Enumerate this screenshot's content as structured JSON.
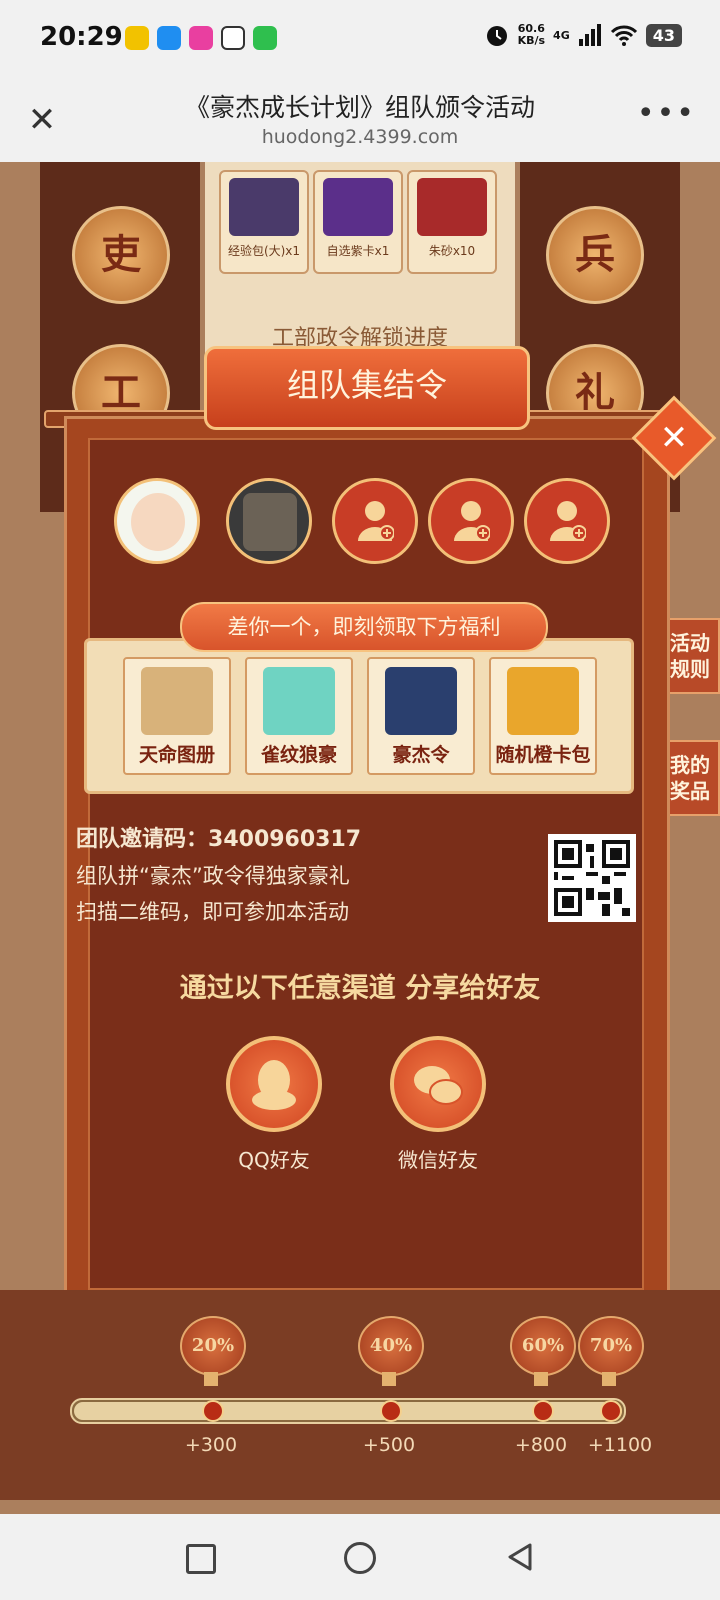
{
  "status_bar": {
    "time": "20:29",
    "speed_value": "60.6",
    "speed_unit": "KB/s",
    "network": "4G",
    "battery": "43"
  },
  "nav": {
    "close_icon": "close-icon",
    "title": "《豪杰成长计划》组队颁令活动",
    "url": "huodong2.4399.com",
    "more_icon": "more-icon"
  },
  "background": {
    "coins": [
      "吏",
      "兵",
      "工",
      "礼"
    ],
    "items": [
      {
        "label": "经验包(大)x1"
      },
      {
        "label": "自选紫卡x1"
      },
      {
        "label": "朱砂x10"
      }
    ],
    "progress_title": "工部政令解锁进度"
  },
  "side_tabs": {
    "rules": "活动规则",
    "prizes": "我的奖品"
  },
  "modal": {
    "title": "组队集结令",
    "banner": "差你一个，即刻领取下方福利",
    "rewards": [
      {
        "label": "天命图册"
      },
      {
        "label": "雀纹狼豪"
      },
      {
        "label": "豪杰令"
      },
      {
        "label": "随机橙卡包"
      }
    ],
    "invite_label": "团队邀请码：",
    "invite_code": "3400960317",
    "desc1": "组队拼“豪杰”政令得独家豪礼",
    "desc2": "扫描二维码，即可参加本活动",
    "share_title": "通过以下任意渠道 分享给好友",
    "share": [
      {
        "label": "QQ好友",
        "icon": "qq-icon"
      },
      {
        "label": "微信好友",
        "icon": "wechat-icon"
      }
    ]
  },
  "progress": {
    "fill_fraction": 1.0,
    "milestones": [
      {
        "percent": "20%",
        "points": "+300"
      },
      {
        "percent": "40%",
        "points": "+500"
      },
      {
        "percent": "60%",
        "points": "+800"
      },
      {
        "percent": "70%",
        "points": "+1100"
      }
    ]
  }
}
